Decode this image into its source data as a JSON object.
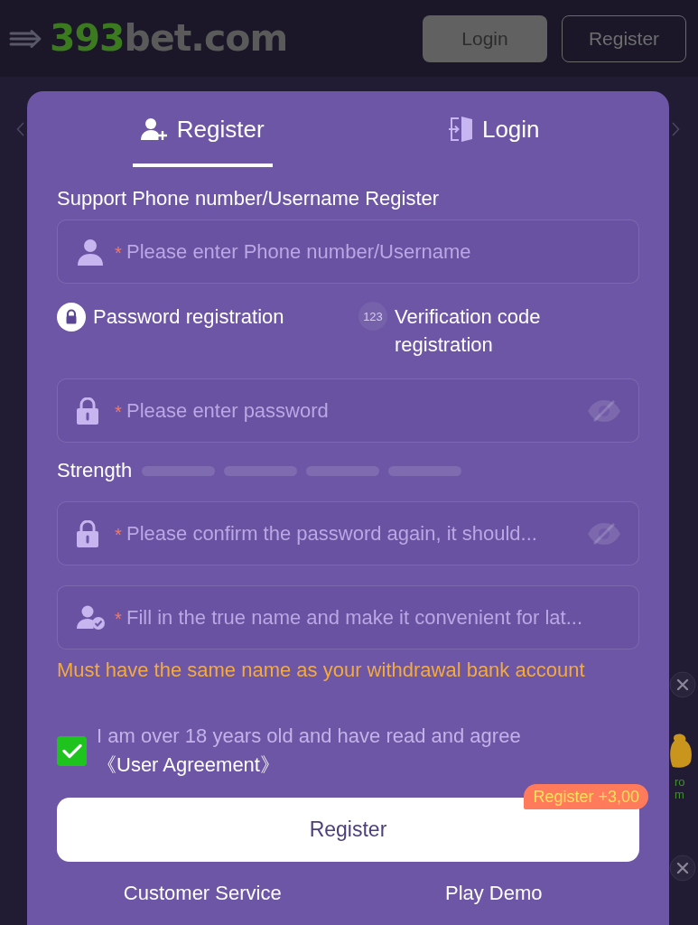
{
  "header": {
    "logo": {
      "number": "393",
      "domain": "bet.com"
    },
    "buttons": [
      {
        "label": "Login",
        "kind": "filled"
      },
      {
        "label": "Register",
        "kind": "outline"
      }
    ]
  },
  "backdrop": {
    "tile_label": [
      "ro",
      "m"
    ]
  },
  "dialog": {
    "tabs": [
      {
        "label": "Register",
        "selected": true
      },
      {
        "label": "Login",
        "selected": false
      }
    ],
    "support_label": "Support Phone number/Username Register",
    "account_field": {
      "kind": "account",
      "required_mark": "*",
      "placeholder": "Please enter Phone number/Username"
    },
    "methods": [
      {
        "kind": "lock",
        "label": "Password registration",
        "selected": true
      },
      {
        "kind": "badge",
        "badge": "123",
        "label": "Verification code registration",
        "selected": false
      }
    ],
    "password_field": {
      "kind": "password",
      "required_mark": "*",
      "placeholder": "Please enter password",
      "visible": false
    },
    "strength": {
      "label": "Strength",
      "segments": [
        {
          "filled": false
        },
        {
          "filled": false
        },
        {
          "filled": false
        },
        {
          "filled": false
        }
      ]
    },
    "confirm_field": {
      "kind": "password",
      "required_mark": "*",
      "placeholder": "Please confirm the password again, it should...",
      "visible": false
    },
    "name_field": {
      "kind": "real_name",
      "required_mark": "*",
      "placeholder": "Fill in the true name and make it convenient for lat..."
    },
    "name_hint": "Must have the same name as your withdrawal bank account",
    "agreement": {
      "checked": true,
      "text": "I am over 18 years old and have read and agree",
      "link": "《User Agreement》"
    },
    "submit": {
      "label": "Register",
      "bonus": "Register +3,00"
    },
    "links": [
      {
        "label": "Customer Service"
      },
      {
        "label": "Play Demo"
      }
    ]
  }
}
